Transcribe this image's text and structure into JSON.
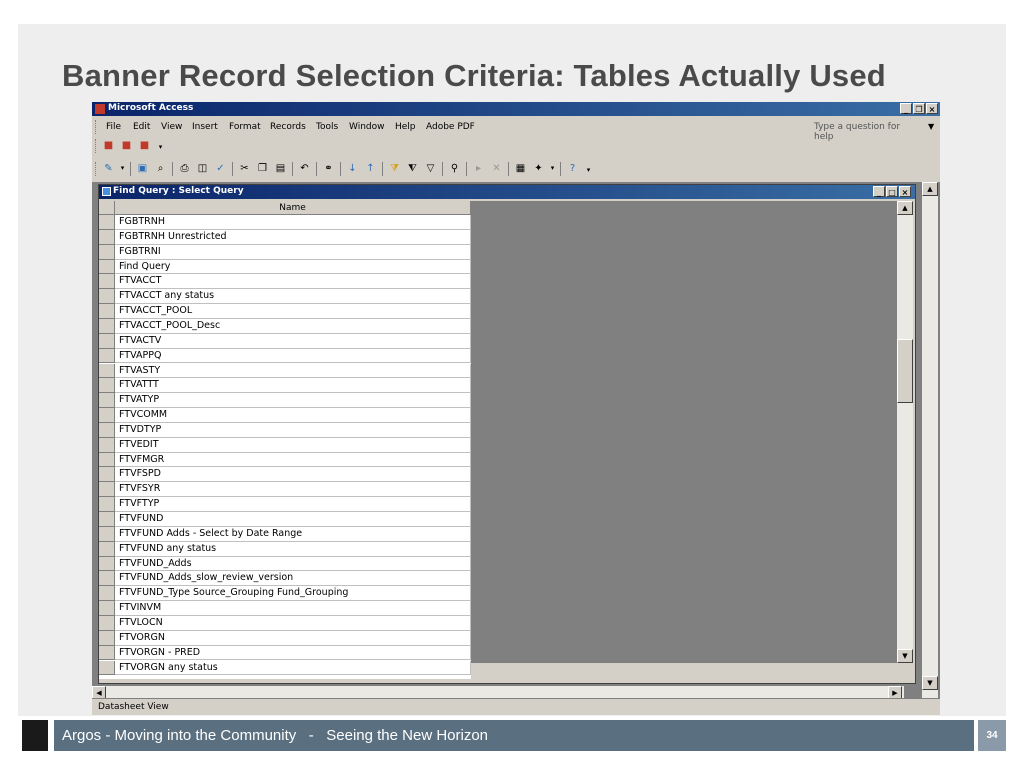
{
  "slide": {
    "title": "Banner Record Selection Criteria: Tables Actually Used",
    "footer_text": "Argos - Moving into the Community   -   Seeing the New Horizon",
    "page_number": "34"
  },
  "window": {
    "title": "Microsoft Access",
    "minimize": "_",
    "restore": "❐",
    "close": "×"
  },
  "menu": {
    "items": [
      "File",
      "Edit",
      "View",
      "Insert",
      "Format",
      "Records",
      "Tools",
      "Window",
      "Help",
      "Adobe PDF"
    ],
    "help_placeholder": "Type a question for help"
  },
  "toolbar1": {
    "icons": [
      "pdf-icon",
      "pdf-export-icon",
      "pdf-settings-icon"
    ]
  },
  "toolbar2": {
    "icons": [
      "view-icon",
      "save-icon",
      "search-icon",
      "print-icon",
      "print-preview-icon",
      "spelling-icon",
      "cut-icon",
      "copy-icon",
      "paste-icon",
      "undo-icon",
      "hyperlink-icon",
      "sort-ascending-icon",
      "sort-descending-icon",
      "filter-selection-icon",
      "filter-form-icon",
      "apply-filter-icon",
      "find-icon",
      "new-record-icon",
      "delete-record-icon",
      "database-window-icon",
      "new-object-icon",
      "help-icon"
    ]
  },
  "query_window": {
    "title": "Find Query : Select Query",
    "column_header": "Name",
    "rows": [
      "FGBTRNH",
      "FGBTRNH Unrestricted",
      "FGBTRNI",
      "Find Query",
      "FTVACCT",
      "FTVACCT any status",
      "FTVACCT_POOL",
      "FTVACCT_POOL_Desc",
      "FTVACTV",
      "FTVAPPQ",
      "FTVASTY",
      "FTVATTT",
      "FTVATYP",
      "FTVCOMM",
      "FTVDTYP",
      "FTVEDIT",
      "FTVFMGR",
      "FTVFSPD",
      "FTVFSYR",
      "FTVFTYP",
      "FTVFUND",
      "FTVFUND Adds - Select by Date Range",
      "FTVFUND any status",
      "FTVFUND_Adds",
      "FTVFUND_Adds_slow_review_version",
      "FTVFUND_Type Source_Grouping Fund_Grouping",
      "FTVINVM",
      "FTVLOCN",
      "FTVORGN",
      "FTVORGN - PRED",
      "FTVORGN any status"
    ]
  },
  "status": {
    "text": "Datasheet View"
  }
}
